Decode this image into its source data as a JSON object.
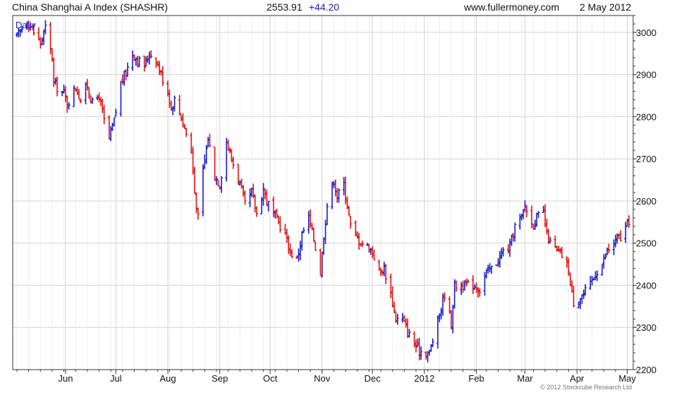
{
  "header": {
    "title": "China Shanghai A Index (SHASHR)",
    "last_price": "2553.91",
    "change": "+44.20",
    "website": "www.fullermoney.com",
    "date": "2 May 2012"
  },
  "footer": {
    "copyright": "© 2012 Stockcube Research Ltd"
  },
  "colors": {
    "up": "#1a1acc",
    "down": "#e01010",
    "grid": "#d4d4d4",
    "frame": "#333333"
  },
  "chart_data": {
    "type": "ohlc",
    "period_label": "Daily",
    "x_tick_labels": [
      "Jun",
      "Jul",
      "Aug",
      "Sep",
      "Oct",
      "Nov",
      "Dec",
      "2012",
      "Feb",
      "Mar",
      "Apr",
      "May"
    ],
    "y_tick_labels": [
      2200,
      2300,
      2400,
      2500,
      2600,
      2700,
      2800,
      2900,
      3000
    ],
    "ylim": [
      2200,
      3040
    ],
    "grid": true,
    "x_start": "2011-05-03",
    "x_end": "2012-05-02",
    "series": [
      {
        "date": "2011-05-03",
        "close": 2990
      },
      {
        "date": "2011-05-06",
        "close": 3010
      },
      {
        "date": "2011-05-09",
        "close": 3030
      },
      {
        "date": "2011-05-13",
        "close": 3000
      },
      {
        "date": "2011-05-17",
        "close": 2975
      },
      {
        "date": "2011-05-20",
        "close": 3010
      },
      {
        "date": "2011-05-24",
        "close": 2940
      },
      {
        "date": "2011-05-25",
        "close": 2880
      },
      {
        "date": "2011-05-27",
        "close": 2870
      },
      {
        "date": "2011-05-31",
        "close": 2855
      },
      {
        "date": "2011-06-02",
        "close": 2830
      },
      {
        "date": "2011-06-07",
        "close": 2870
      },
      {
        "date": "2011-06-10",
        "close": 2840
      },
      {
        "date": "2011-06-14",
        "close": 2875
      },
      {
        "date": "2011-06-17",
        "close": 2830
      },
      {
        "date": "2011-06-21",
        "close": 2850
      },
      {
        "date": "2011-06-24",
        "close": 2790
      },
      {
        "date": "2011-06-27",
        "close": 2745
      },
      {
        "date": "2011-06-30",
        "close": 2790
      },
      {
        "date": "2011-07-04",
        "close": 2880
      },
      {
        "date": "2011-07-07",
        "close": 2905
      },
      {
        "date": "2011-07-11",
        "close": 2950
      },
      {
        "date": "2011-07-14",
        "close": 2935
      },
      {
        "date": "2011-07-18",
        "close": 2920
      },
      {
        "date": "2011-07-21",
        "close": 2950
      },
      {
        "date": "2011-07-25",
        "close": 2935
      },
      {
        "date": "2011-07-28",
        "close": 2900
      },
      {
        "date": "2011-08-01",
        "close": 2860
      },
      {
        "date": "2011-08-03",
        "close": 2820
      },
      {
        "date": "2011-08-05",
        "close": 2840
      },
      {
        "date": "2011-08-09",
        "close": 2800
      },
      {
        "date": "2011-08-12",
        "close": 2760
      },
      {
        "date": "2011-08-15",
        "close": 2720
      },
      {
        "date": "2011-08-17",
        "close": 2620
      },
      {
        "date": "2011-08-19",
        "close": 2560
      },
      {
        "date": "2011-08-22",
        "close": 2670
      },
      {
        "date": "2011-08-25",
        "close": 2750
      },
      {
        "date": "2011-08-29",
        "close": 2660
      },
      {
        "date": "2011-09-01",
        "close": 2640
      },
      {
        "date": "2011-09-05",
        "close": 2740
      },
      {
        "date": "2011-09-08",
        "close": 2700
      },
      {
        "date": "2011-09-13",
        "close": 2640
      },
      {
        "date": "2011-09-16",
        "close": 2590
      },
      {
        "date": "2011-09-20",
        "close": 2620
      },
      {
        "date": "2011-09-23",
        "close": 2570
      },
      {
        "date": "2011-09-27",
        "close": 2630
      },
      {
        "date": "2011-09-29",
        "close": 2600
      },
      {
        "date": "2011-10-10",
        "close": 2520
      },
      {
        "date": "2011-10-13",
        "close": 2480
      },
      {
        "date": "2011-10-17",
        "close": 2460
      },
      {
        "date": "2011-10-20",
        "close": 2520
      },
      {
        "date": "2011-10-24",
        "close": 2560
      },
      {
        "date": "2011-10-27",
        "close": 2510
      },
      {
        "date": "2011-10-31",
        "close": 2430
      },
      {
        "date": "2011-11-02",
        "close": 2520
      },
      {
        "date": "2011-11-04",
        "close": 2590
      },
      {
        "date": "2011-11-08",
        "close": 2650
      },
      {
        "date": "2011-11-10",
        "close": 2610
      },
      {
        "date": "2011-11-14",
        "close": 2640
      },
      {
        "date": "2011-11-16",
        "close": 2590
      },
      {
        "date": "2011-11-18",
        "close": 2540
      },
      {
        "date": "2011-11-22",
        "close": 2510
      },
      {
        "date": "2011-11-25",
        "close": 2500
      },
      {
        "date": "2011-11-29",
        "close": 2490
      },
      {
        "date": "2011-12-01",
        "close": 2480
      },
      {
        "date": "2011-12-05",
        "close": 2430
      },
      {
        "date": "2011-12-08",
        "close": 2440
      },
      {
        "date": "2011-12-12",
        "close": 2380
      },
      {
        "date": "2011-12-15",
        "close": 2320
      },
      {
        "date": "2011-12-19",
        "close": 2320
      },
      {
        "date": "2011-12-22",
        "close": 2290
      },
      {
        "date": "2011-12-26",
        "close": 2260
      },
      {
        "date": "2011-12-29",
        "close": 2245
      },
      {
        "date": "2012-01-04",
        "close": 2240
      },
      {
        "date": "2012-01-06",
        "close": 2270
      },
      {
        "date": "2012-01-10",
        "close": 2330
      },
      {
        "date": "2012-01-13",
        "close": 2380
      },
      {
        "date": "2012-01-17",
        "close": 2310
      },
      {
        "date": "2012-01-19",
        "close": 2400
      },
      {
        "date": "2012-01-31",
        "close": 2400
      },
      {
        "date": "2012-02-03",
        "close": 2390
      },
      {
        "date": "2012-02-07",
        "close": 2430
      },
      {
        "date": "2012-02-10",
        "close": 2440
      },
      {
        "date": "2012-02-14",
        "close": 2460
      },
      {
        "date": "2012-02-17",
        "close": 2480
      },
      {
        "date": "2012-02-21",
        "close": 2490
      },
      {
        "date": "2012-02-24",
        "close": 2540
      },
      {
        "date": "2012-02-28",
        "close": 2560
      },
      {
        "date": "2012-03-01",
        "close": 2590
      },
      {
        "date": "2012-03-05",
        "close": 2545
      },
      {
        "date": "2012-03-08",
        "close": 2560
      },
      {
        "date": "2012-03-12",
        "close": 2570
      },
      {
        "date": "2012-03-14",
        "close": 2520
      },
      {
        "date": "2012-03-16",
        "close": 2500
      },
      {
        "date": "2012-03-20",
        "close": 2480
      },
      {
        "date": "2012-03-23",
        "close": 2470
      },
      {
        "date": "2012-03-27",
        "close": 2440
      },
      {
        "date": "2012-03-28",
        "close": 2400
      },
      {
        "date": "2012-03-30",
        "close": 2360
      },
      {
        "date": "2012-04-05",
        "close": 2380
      },
      {
        "date": "2012-04-09",
        "close": 2400
      },
      {
        "date": "2012-04-12",
        "close": 2430
      },
      {
        "date": "2012-04-16",
        "close": 2450
      },
      {
        "date": "2012-04-19",
        "close": 2480
      },
      {
        "date": "2012-04-23",
        "close": 2500
      },
      {
        "date": "2012-04-26",
        "close": 2515
      },
      {
        "date": "2012-04-27",
        "close": 2510
      },
      {
        "date": "2012-05-02",
        "close": 2554
      }
    ]
  }
}
